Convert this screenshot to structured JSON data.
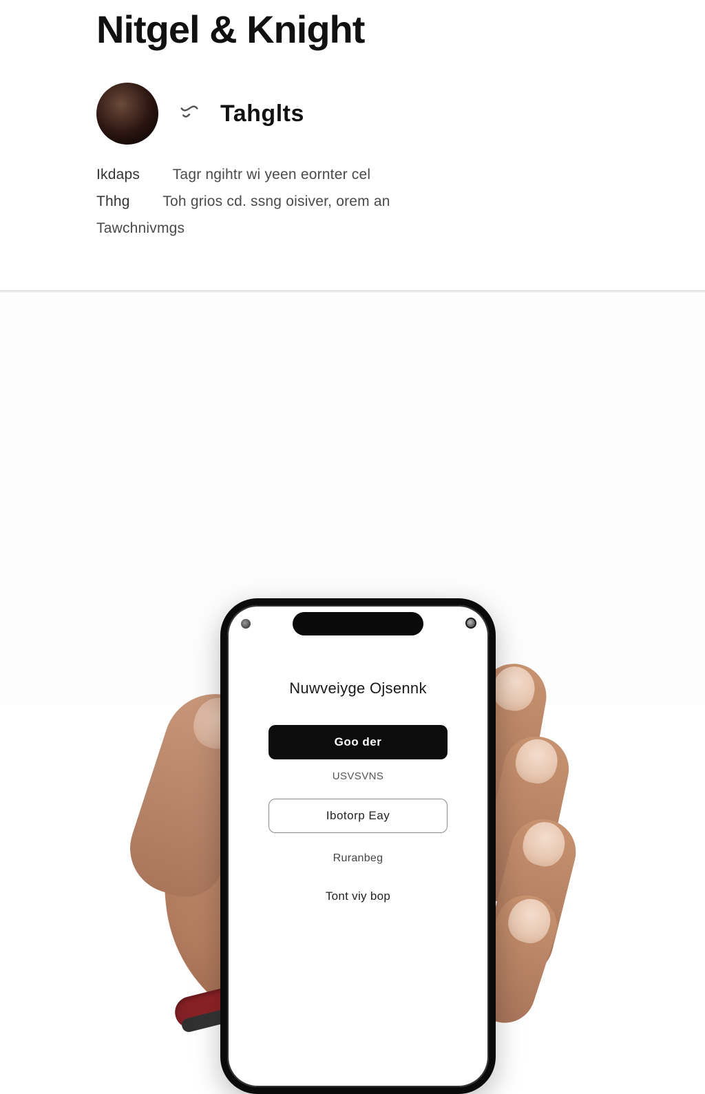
{
  "article": {
    "title": "Nitgel & Knight",
    "profile_name": "Tahglts",
    "body_line1_lead": "Ikdaps",
    "body_line1_rest": "Tagr ngihtr wi  yeen eornter cel",
    "body_line2_lead": "Thhg",
    "body_line2_rest": "Toh grios cd. ssng oisiver,  orem an",
    "body_line3": "Tawchnivmgs"
  },
  "phone": {
    "screen_title": "Nuwveiyge Ojsennk",
    "primary_button": "Goo der",
    "link_1": "usvsvns",
    "outline_button": "Ibotorp Eay",
    "option_text": "Ruranbeg",
    "footer_link": "Tont viy bop"
  }
}
